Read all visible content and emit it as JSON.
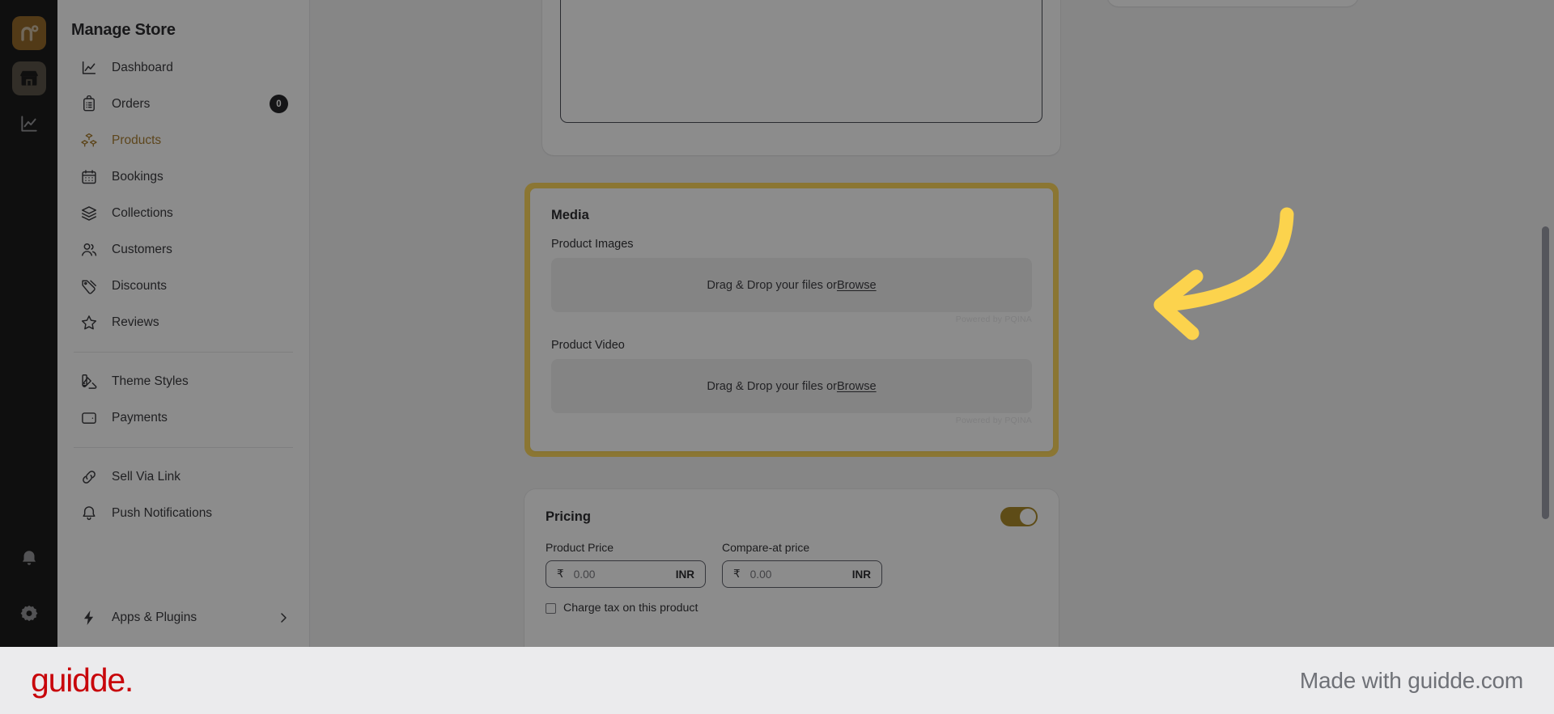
{
  "colors": {
    "rail_bg": "#050505",
    "logo_bg": "#8a5a14",
    "accent_amber": "#a1721f",
    "highlight_yellow": "#fcd34d",
    "arrow_yellow": "#fcd34d",
    "toggle_on": "#a37e15",
    "guidde_red": "#c8060b",
    "dim_overlay": "rgba(26,26,26,0.50)"
  },
  "rail": {
    "logo": {
      "icon": "brand-n-degree-logo",
      "label": "n°"
    },
    "items": [
      {
        "icon": "store-icon",
        "name": "store",
        "active": true
      },
      {
        "icon": "analytics-chart-icon",
        "name": "analytics",
        "active": false
      }
    ],
    "bottom_items": [
      {
        "icon": "bell-icon",
        "name": "notifications"
      },
      {
        "icon": "gear-icon",
        "name": "settings"
      }
    ]
  },
  "sidebar": {
    "title": "Manage Store",
    "groups": [
      {
        "items": [
          {
            "label": "Dashboard",
            "icon": "chart-line-icon",
            "selected": false
          },
          {
            "label": "Orders",
            "icon": "clipboard-list-icon",
            "selected": false,
            "badge": "0"
          },
          {
            "label": "Products",
            "icon": "boxes-icon",
            "selected": true
          },
          {
            "label": "Bookings",
            "icon": "calendar-icon",
            "selected": false
          },
          {
            "label": "Collections",
            "icon": "layers-icon",
            "selected": false
          },
          {
            "label": "Customers",
            "icon": "users-icon",
            "selected": false
          },
          {
            "label": "Discounts",
            "icon": "tag-icon",
            "selected": false
          },
          {
            "label": "Reviews",
            "icon": "star-icon",
            "selected": false
          }
        ]
      },
      {
        "items": [
          {
            "label": "Theme Styles",
            "icon": "palette-icon",
            "selected": false
          },
          {
            "label": "Payments",
            "icon": "wallet-icon",
            "selected": false
          }
        ]
      },
      {
        "items": [
          {
            "label": "Sell Via Link",
            "icon": "link-icon",
            "selected": false
          },
          {
            "label": "Push Notifications",
            "icon": "bell-icon",
            "selected": false
          }
        ]
      }
    ],
    "footer_item": {
      "label": "Apps & Plugins",
      "icon": "bolt-icon",
      "chevron": "chevron-right-icon"
    }
  },
  "main": {
    "media_card": {
      "heading": "Media",
      "images": {
        "label": "Product Images",
        "dropzone_text": "Drag & Drop your files or ",
        "dropzone_link": "Browse",
        "credit": "Powered by PQINA"
      },
      "video": {
        "label": "Product Video",
        "dropzone_text": "Drag & Drop your files or ",
        "dropzone_link": "Browse",
        "credit": "Powered by PQINA"
      }
    },
    "pricing_card": {
      "heading": "Pricing",
      "toggle_state": "on",
      "product_price": {
        "label": "Product Price",
        "currency_symbol": "₹",
        "value": "0.00",
        "unit": "INR"
      },
      "compare_at_price": {
        "label": "Compare-at price",
        "currency_symbol": "₹",
        "value": "0.00",
        "unit": "INR"
      },
      "tax_checkbox": {
        "label": "Charge tax on this product",
        "checked": false
      }
    }
  },
  "annotation": {
    "arrow": {
      "shape": "curved-left-arrow",
      "points_to": "media-card"
    }
  },
  "guidde": {
    "logo": "guidde.",
    "made_with": "Made with guidde.com"
  }
}
